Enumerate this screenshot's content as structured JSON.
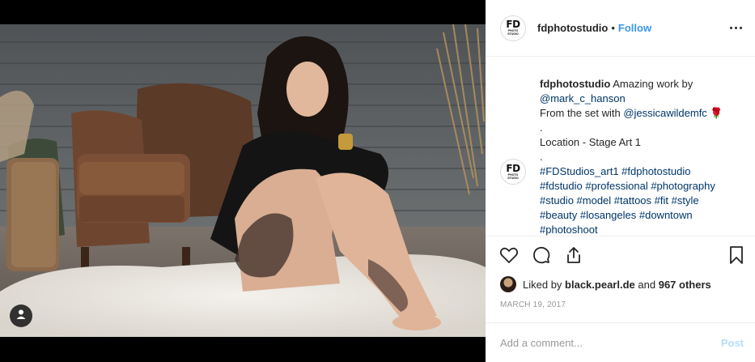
{
  "post": {
    "account": "fdphotostudio",
    "separator": "•",
    "follow_label": "Follow",
    "logo": {
      "main": "FD",
      "sub_line1": "PHOTO",
      "sub_line2": "STUDIO"
    },
    "more_icon": "more-horizontal-icon",
    "tag_icon": "user-tag-icon"
  },
  "caption": {
    "username": "fdphotostudio",
    "line1": "Amazing work by",
    "mention1": "@mark_c_hanson",
    "line2_prefix": "From the set with ",
    "mention2": "@jessicawildemfc",
    "line2_suffix": " 🌹",
    "dot1": ".",
    "location": "Location - Stage Art 1",
    "dot2": ".",
    "hashtags_line1": "#FDStudios_art1 #fdphotostudio",
    "hashtags_line2": "#fdstudio #professional #photography",
    "hashtags_line3": "#studio #model #tattoos #fit #style",
    "hashtags_line4": "#beauty #losangeles #downtown",
    "hashtags_line5": "#photoshoot"
  },
  "actions": {
    "like_icon": "heart-icon",
    "comment_icon": "comment-icon",
    "share_icon": "share-icon",
    "save_icon": "bookmark-icon"
  },
  "likes": {
    "prefix": "Liked by ",
    "user": "black.pearl.de",
    "middle": " and ",
    "others": "967 others"
  },
  "date": "MARCH 19, 2017",
  "comment": {
    "placeholder": "Add a comment...",
    "post_label": "Post"
  },
  "colors": {
    "link": "#003569",
    "follow": "#3897f0",
    "post_disabled": "#b2dffc",
    "muted": "#999999"
  }
}
